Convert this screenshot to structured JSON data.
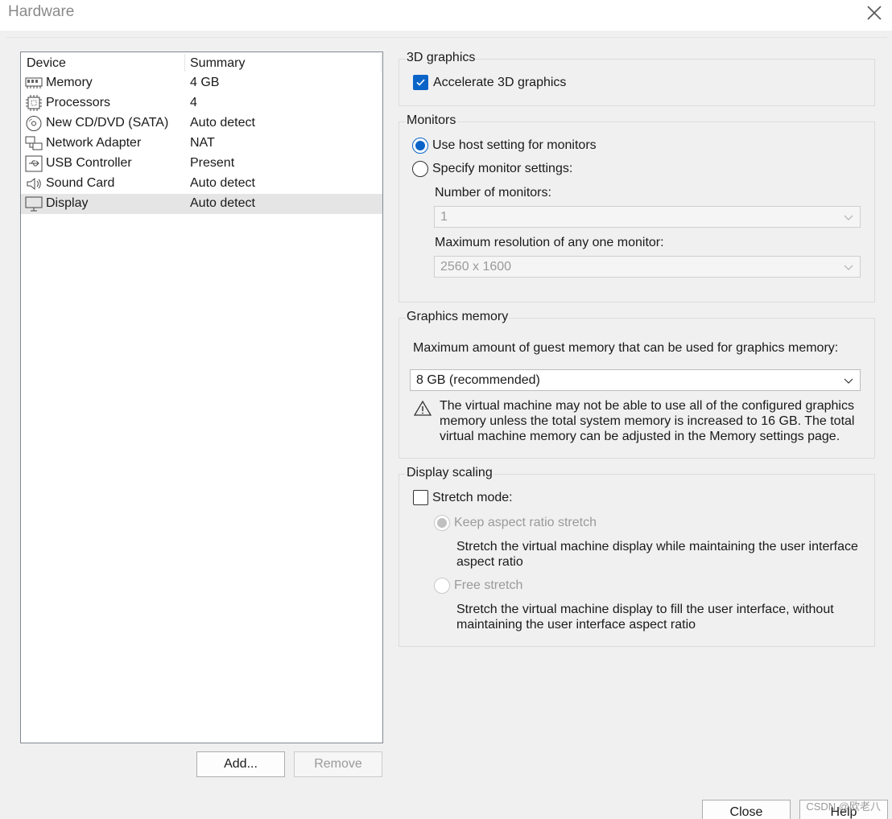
{
  "window": {
    "title": "Hardware"
  },
  "device_list": {
    "headers": {
      "device": "Device",
      "summary": "Summary"
    },
    "items": [
      {
        "icon": "memory-icon",
        "name": "Memory",
        "summary": "4 GB",
        "selected": false
      },
      {
        "icon": "processor-icon",
        "name": "Processors",
        "summary": "4",
        "selected": false
      },
      {
        "icon": "cd-dvd-icon",
        "name": "New CD/DVD (SATA)",
        "summary": "Auto detect",
        "selected": false
      },
      {
        "icon": "network-adapter-icon",
        "name": "Network Adapter",
        "summary": "NAT",
        "selected": false
      },
      {
        "icon": "usb-icon",
        "name": "USB Controller",
        "summary": "Present",
        "selected": false
      },
      {
        "icon": "speaker-icon",
        "name": "Sound Card",
        "summary": "Auto detect",
        "selected": false
      },
      {
        "icon": "monitor-icon",
        "name": "Display",
        "summary": "Auto detect",
        "selected": true
      }
    ],
    "add_label": "Add...",
    "remove_label": "Remove"
  },
  "graphics3d": {
    "title": "3D graphics",
    "accelerate_label": "Accelerate 3D graphics",
    "accelerate_checked": true
  },
  "monitors": {
    "title": "Monitors",
    "use_host_label": "Use host setting for monitors",
    "specify_label": "Specify monitor settings:",
    "selected": "use_host",
    "number_label": "Number of monitors:",
    "number_value": "1",
    "max_res_label": "Maximum resolution of any one monitor:",
    "max_res_value": "2560 x 1600"
  },
  "graphics_memory": {
    "title": "Graphics memory",
    "label": "Maximum amount of guest memory that can be used for graphics memory:",
    "value": "8 GB (recommended)",
    "warning_line1": "The virtual machine may not be able to use all of the configured graphics",
    "warning_line2": "memory unless the total system memory is increased to 16 GB. The total",
    "warning_line3": "virtual machine memory can be adjusted in the Memory settings page."
  },
  "display_scaling": {
    "title": "Display scaling",
    "stretch_label": "Stretch mode:",
    "stretch_checked": false,
    "keep_aspect_label": "Keep aspect ratio stretch",
    "keep_aspect_desc_line1": "Stretch the virtual machine display while maintaining the user interface",
    "keep_aspect_desc_line2": "aspect ratio",
    "free_stretch_label": "Free stretch",
    "free_stretch_desc_line1": "Stretch the virtual machine display to fill the user interface, without",
    "free_stretch_desc_line2": "maintaining the user interface aspect ratio"
  },
  "footer": {
    "close_label": "Close",
    "help_label": "Help",
    "watermark": "CSDN @欧老八"
  },
  "colors": {
    "accent": "#0a64c8",
    "selection": "#e5e5e5"
  }
}
